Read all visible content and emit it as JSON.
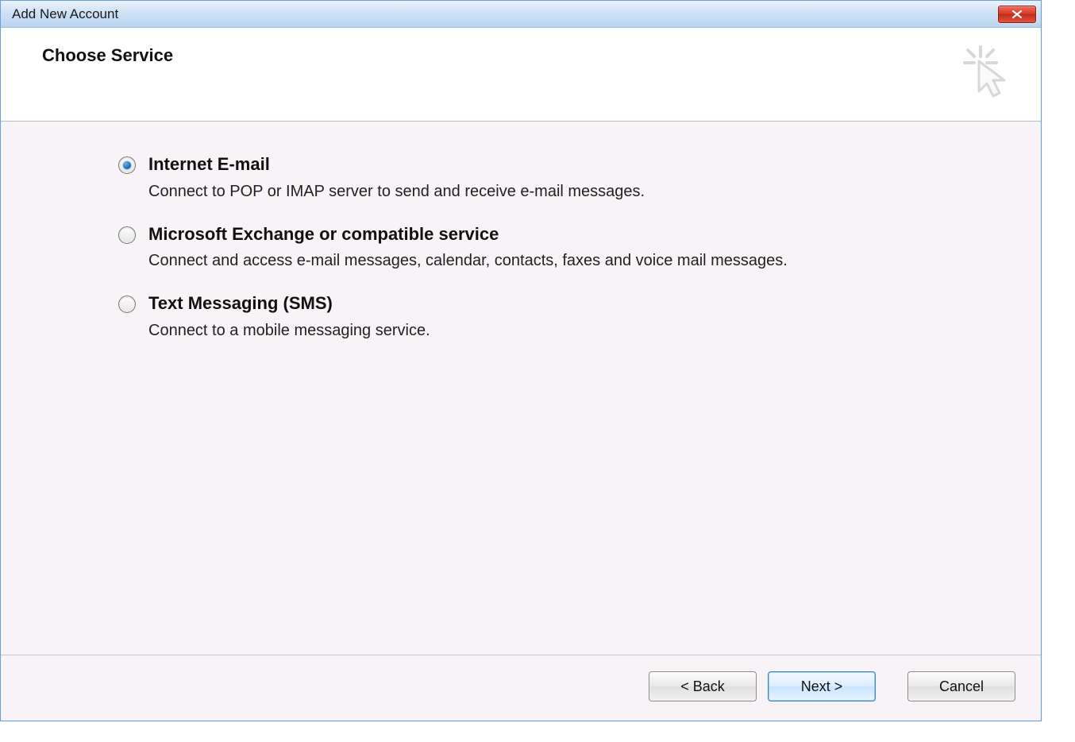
{
  "window": {
    "title": "Add New Account"
  },
  "header": {
    "title": "Choose Service"
  },
  "options": [
    {
      "title": "Internet E-mail",
      "desc": "Connect to POP or IMAP server to send and receive e-mail messages.",
      "checked": true
    },
    {
      "title": "Microsoft Exchange or compatible service",
      "desc": "Connect and access e-mail messages, calendar, contacts, faxes and voice mail messages.",
      "checked": false
    },
    {
      "title": "Text Messaging (SMS)",
      "desc": "Connect to a mobile messaging service.",
      "checked": false
    }
  ],
  "buttons": {
    "back": "< Back",
    "next": "Next >",
    "cancel": "Cancel"
  }
}
